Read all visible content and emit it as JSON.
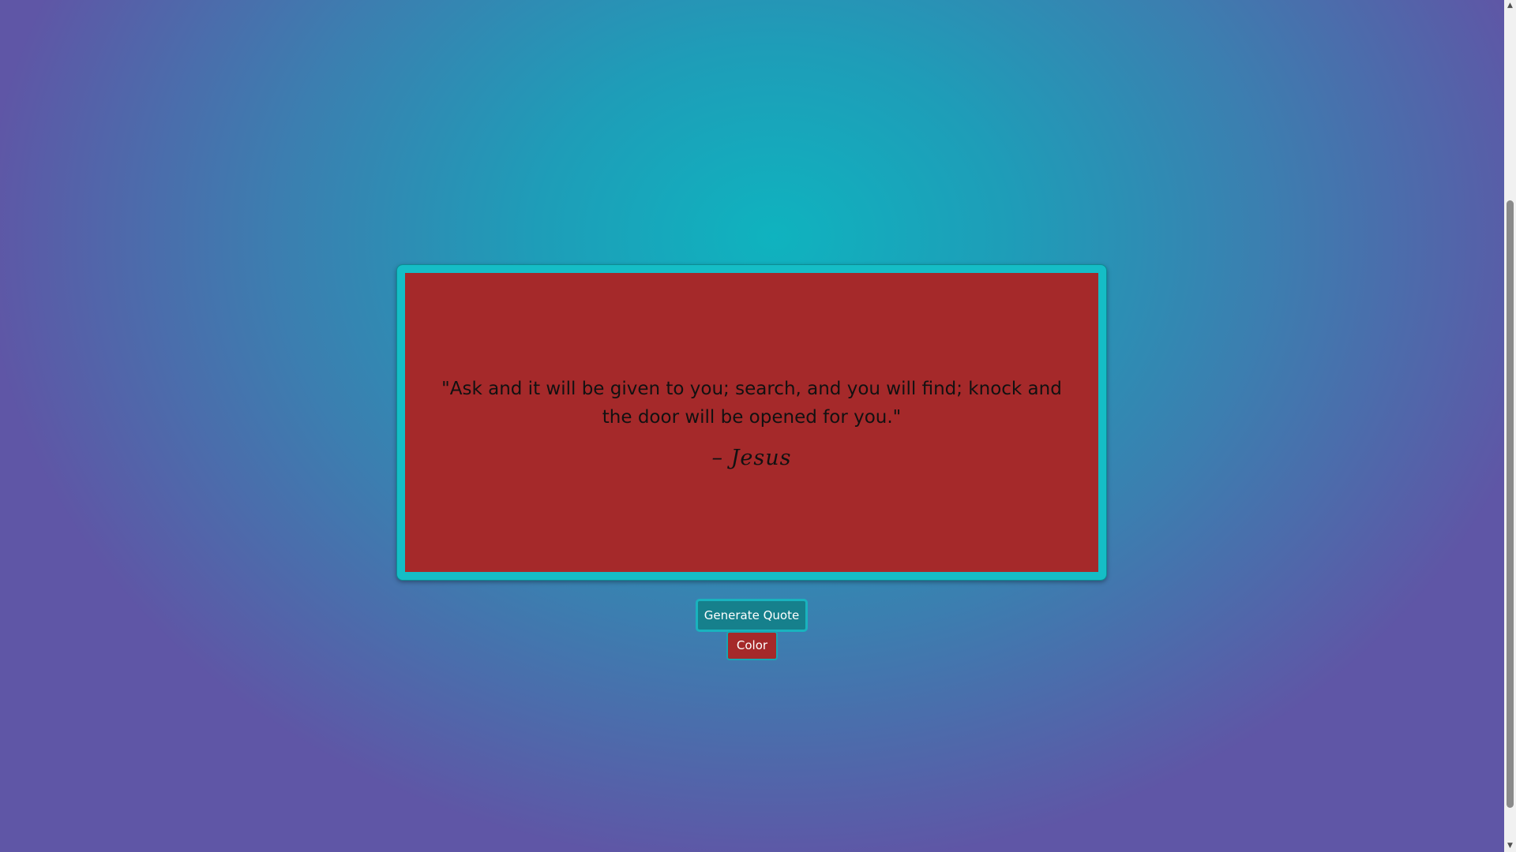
{
  "quote": {
    "text": "\"Ask and it will be given to you; search, and you will find; knock and the door will be opened for you.\"",
    "author": "– Jesus"
  },
  "buttons": {
    "generate_label": "Generate Quote",
    "color_label": "Color"
  },
  "colors": {
    "card_background": "#a5292a",
    "frame_border": "#15bdc6",
    "generate_button": "#16808c",
    "color_button": "#a5292a"
  },
  "scrollbar": {
    "up_icon": "scroll-up-arrow",
    "down_icon": "scroll-down-arrow"
  }
}
